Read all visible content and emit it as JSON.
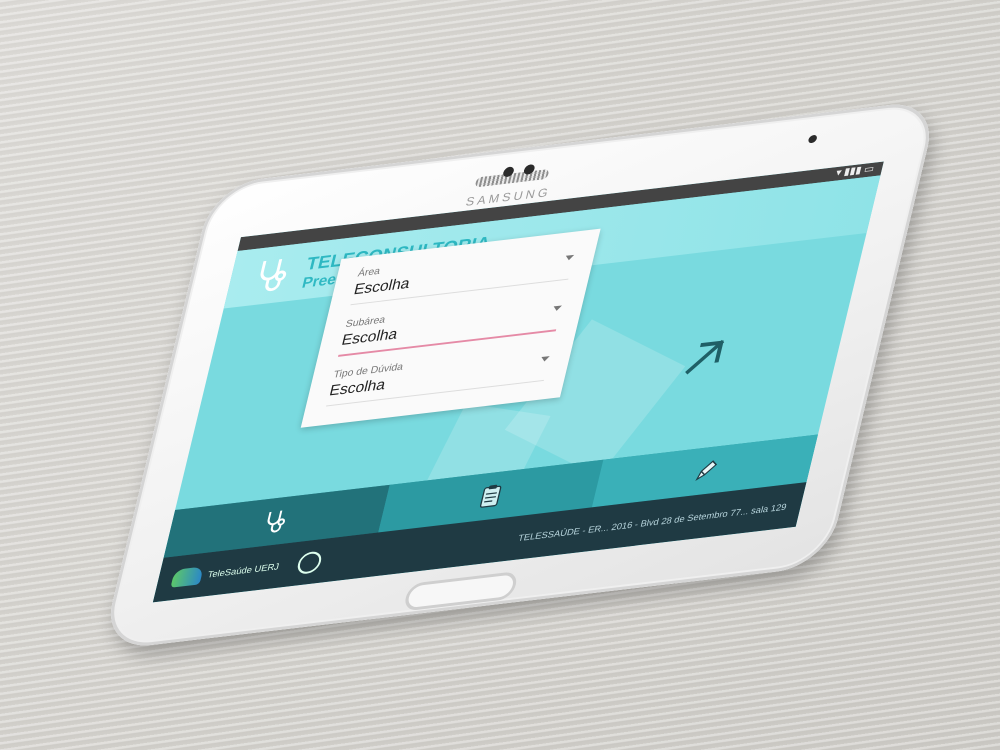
{
  "device": {
    "brand": "SAMSUNG"
  },
  "app": {
    "title": "TELECONSULTORIA",
    "subtitle": "Preencha os campos abaixo:"
  },
  "form": {
    "fields": [
      {
        "label": "Área",
        "value": "Escolha"
      },
      {
        "label": "Subárea",
        "value": "Escolha"
      },
      {
        "label": "Tipo de Dúvida",
        "value": "Escolha"
      }
    ]
  },
  "footer": {
    "logo_left_text": "TeleSaúde UERJ",
    "info_text": "TELESSAÚDE - ER... 2016 - Blvd 28 de Setembro 77... sala 129"
  },
  "colors": {
    "primary": "#79dadf",
    "header_text": "#2eb8c2",
    "accent_line": "#e58aa6",
    "footer_bg": "#1f3a43",
    "bar_dark": "#22727a"
  },
  "icons": {
    "header": "stethoscope-icon",
    "next": "arrow-right-icon",
    "bottom_1": "stethoscope-icon",
    "bottom_2": "clipboard-icon",
    "bottom_3": "pencil-icon"
  }
}
